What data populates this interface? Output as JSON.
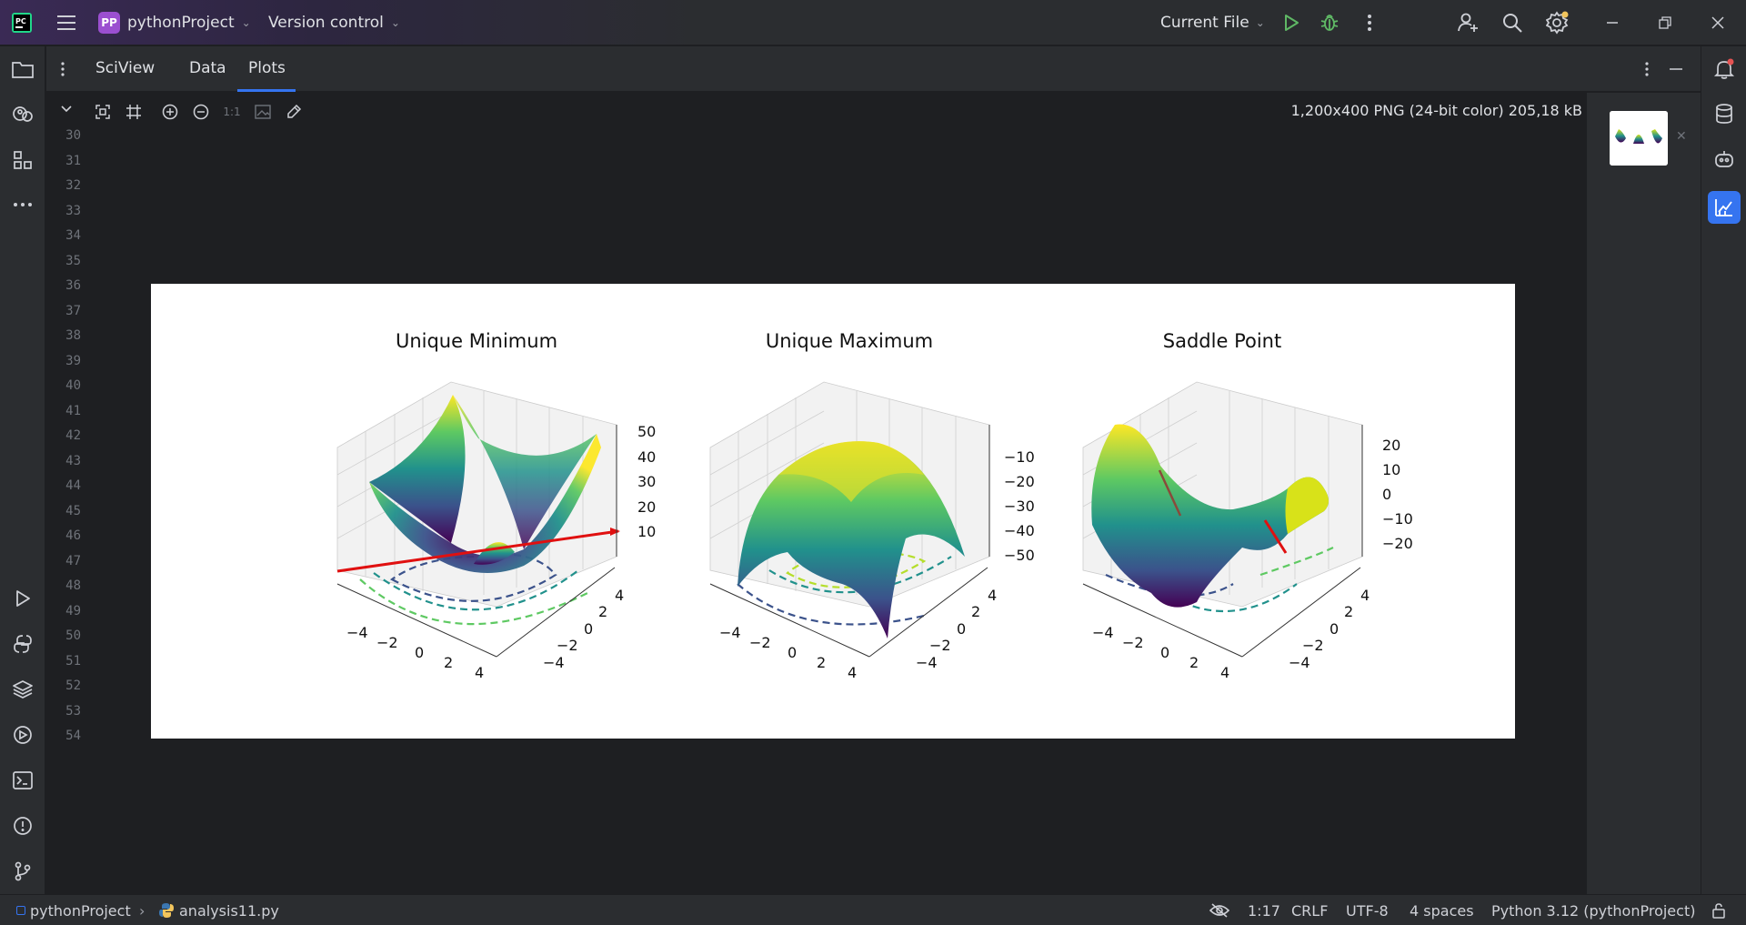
{
  "topbar": {
    "project_badge": "PP",
    "project_name": "pythonProject",
    "vcs_label": "Version control",
    "run_config": "Current File"
  },
  "sciview": {
    "title": "SciView",
    "tabs": [
      "Data",
      "Plots"
    ],
    "active_tab": "Plots",
    "image_info": "1,200x400 PNG (24-bit color) 205,18 kB",
    "toolbar_zoom_actual": "1:1"
  },
  "gutter": {
    "line_numbers": [
      "30",
      "31",
      "32",
      "33",
      "34",
      "35",
      "36",
      "37",
      "38",
      "39",
      "40",
      "41",
      "42",
      "43",
      "44",
      "45",
      "46",
      "47",
      "48",
      "49",
      "50",
      "51",
      "52",
      "53",
      "54"
    ]
  },
  "plots": [
    {
      "title": "Unique Minimum",
      "z_ticks": [
        "50",
        "40",
        "30",
        "20",
        "10"
      ],
      "x_ticks": [
        "−4",
        "−2",
        "0",
        "2",
        "4"
      ],
      "y_ticks": [
        "4",
        "2",
        "0",
        "−2",
        "−4"
      ]
    },
    {
      "title": "Unique Maximum",
      "z_ticks": [
        "−10",
        "−20",
        "−30",
        "−40",
        "−50"
      ],
      "x_ticks": [
        "−4",
        "−2",
        "0",
        "2",
        "4"
      ],
      "y_ticks": [
        "4",
        "2",
        "0",
        "−2",
        "−4"
      ]
    },
    {
      "title": "Saddle Point",
      "z_ticks": [
        "20",
        "10",
        "0",
        "−10",
        "−20"
      ],
      "x_ticks": [
        "−4",
        "−2",
        "0",
        "2",
        "4"
      ],
      "y_ticks": [
        "4",
        "2",
        "0",
        "−2",
        "−4"
      ]
    }
  ],
  "statusbar": {
    "breadcrumb_project": "pythonProject",
    "breadcrumb_file": "analysis11.py",
    "position": "1:17",
    "line_separator": "CRLF",
    "encoding": "UTF-8",
    "indent": "4 spaces",
    "interpreter": "Python 3.12 (pythonProject)"
  },
  "colors": {
    "accent": "#3574f0",
    "run_green": "#5fb865",
    "project_badge": "#9b4fd0",
    "notification_dot": "#e55353"
  }
}
